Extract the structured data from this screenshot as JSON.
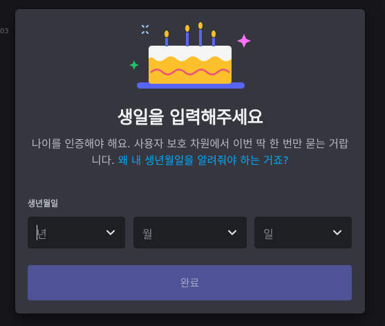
{
  "background": {
    "fragment_text": "03"
  },
  "modal": {
    "title": "생일을 입력해주세요",
    "description_text": "나이를 인증해야 해요. 사용자 보호 차원에서 이번 딱 한 번만 묻는 거랍니다. ",
    "description_link": "왜 내 생년월일을 알려줘야 하는 거죠?",
    "birthday_label": "생년월일",
    "year_placeholder": "년",
    "month_placeholder": "월",
    "day_placeholder": "일",
    "submit_label": "완료"
  },
  "colors": {
    "modal_bg": "#36373e",
    "input_bg": "#1e1f22",
    "link": "#00a8fc",
    "button_bg": "#4e5396",
    "cake_frosting": "#f5f5f5",
    "cake_body": "#fcc02d",
    "cake_plate": "#5865f2",
    "sparkle_pink": "#ff73fa",
    "sparkle_green": "#23c46a",
    "sparkle_blue": "#9ad0ff"
  },
  "icons": {
    "illustration": "birthday-cake-icon",
    "dropdown": "chevron-down-icon"
  }
}
